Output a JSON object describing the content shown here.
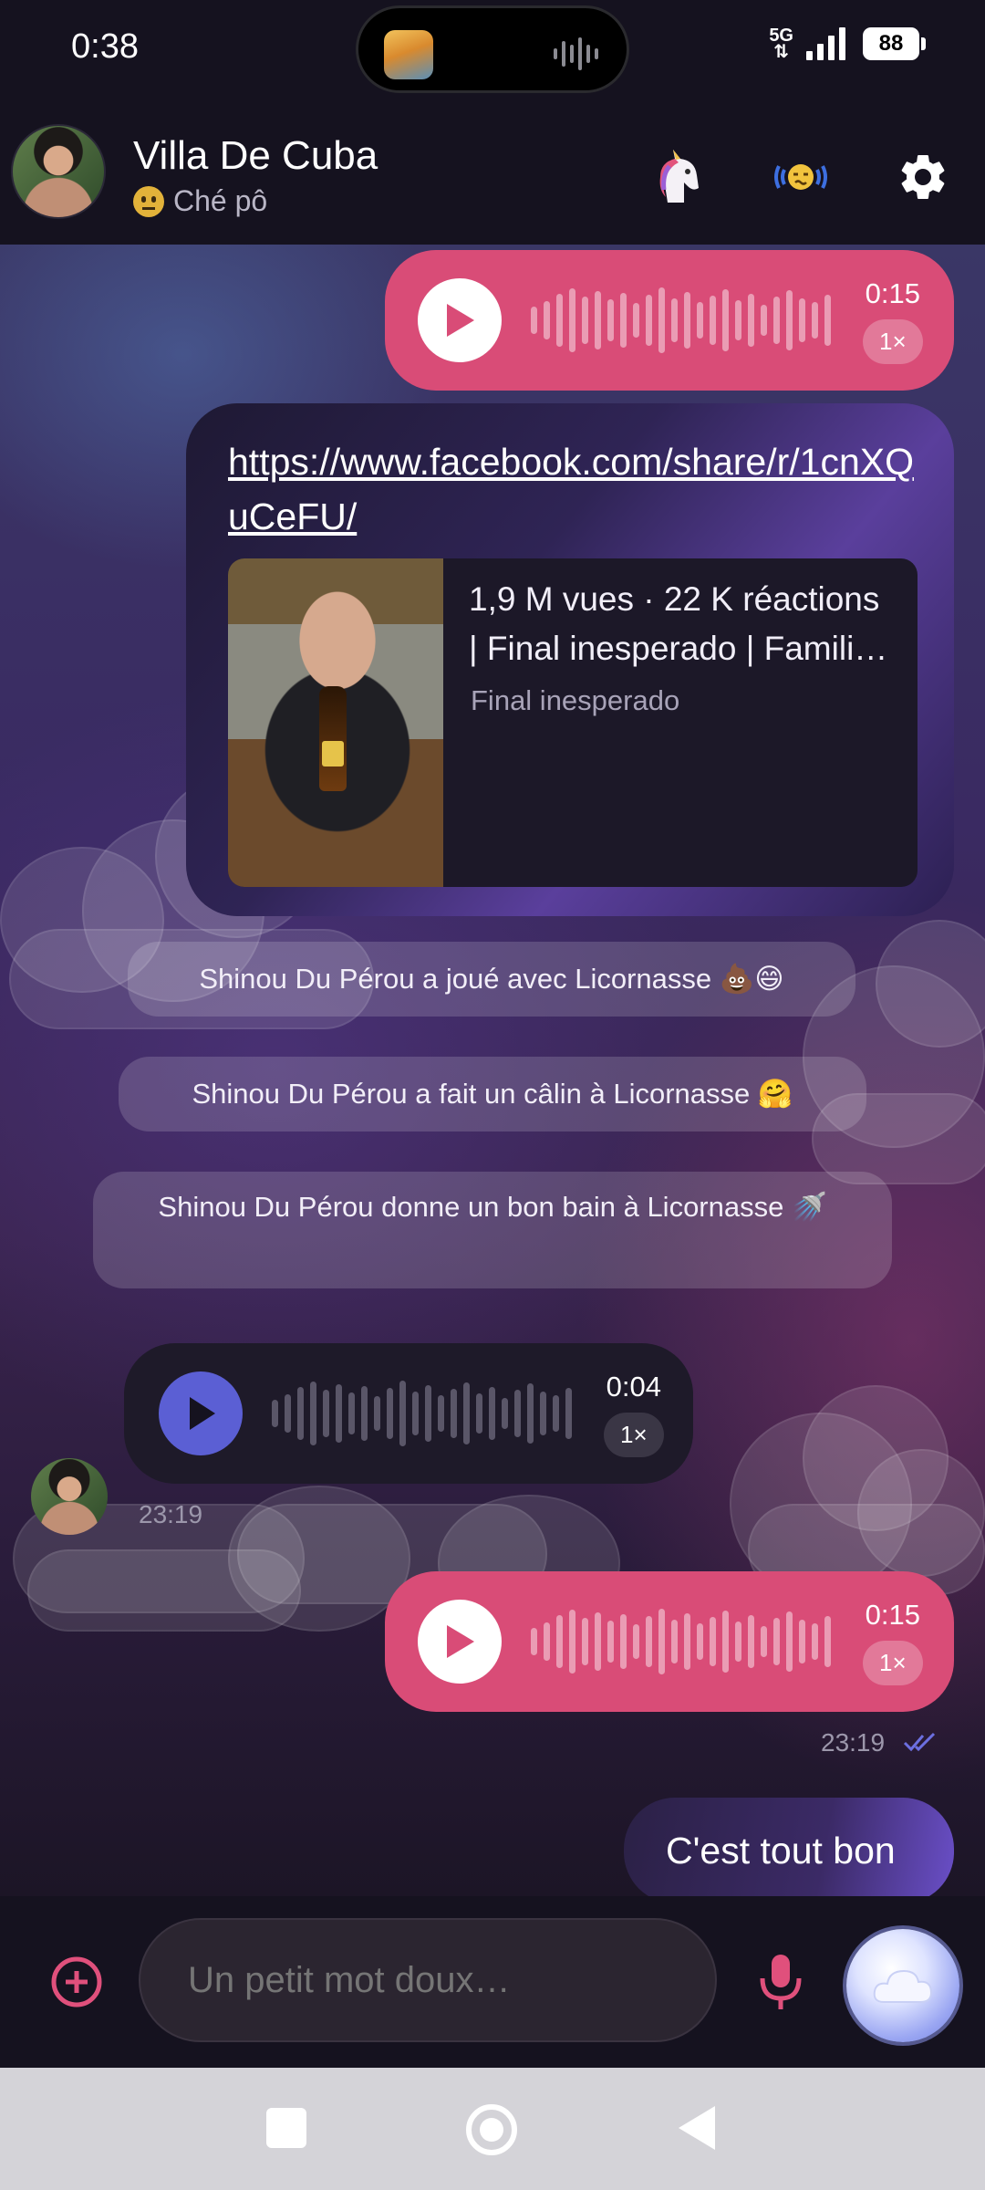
{
  "status_bar": {
    "time": "0:38",
    "network": "5G",
    "battery": "88"
  },
  "header": {
    "title": "Villa De Cuba",
    "subtitle": "Ché pô",
    "icons": [
      "unicorn-icon",
      "vibrate-face-icon",
      "gear-icon"
    ]
  },
  "messages": {
    "voice_top": {
      "duration": "0:15",
      "speed": "1×"
    },
    "link": {
      "url": "https://www.facebook.com/share/r/1cnXQuCeFU/",
      "preview_title_line1": "1,9 M vues · 22 K réactions",
      "preview_title_line2": "| Final inesperado | Famili…",
      "preview_description": "Final inesperado"
    },
    "system": [
      "Shinou Du Pérou a joué avec Licornasse 💩😄",
      "Shinou Du Pérou a fait un câlin à Licornasse 🤗",
      "Shinou Du Pérou donne un bon bain à Licornasse 🚿"
    ],
    "voice_incoming": {
      "duration": "0:04",
      "speed": "1×",
      "time": "23:19"
    },
    "voice_outgoing": {
      "duration": "0:15",
      "speed": "1×",
      "time": "23:19"
    },
    "text_outgoing": "C'est tout bon"
  },
  "composer": {
    "placeholder": "Un petit mot doux…"
  },
  "colors": {
    "accent_pink": "#d94c77",
    "accent_blue": "#5b5fd4",
    "background": "#15121f"
  }
}
